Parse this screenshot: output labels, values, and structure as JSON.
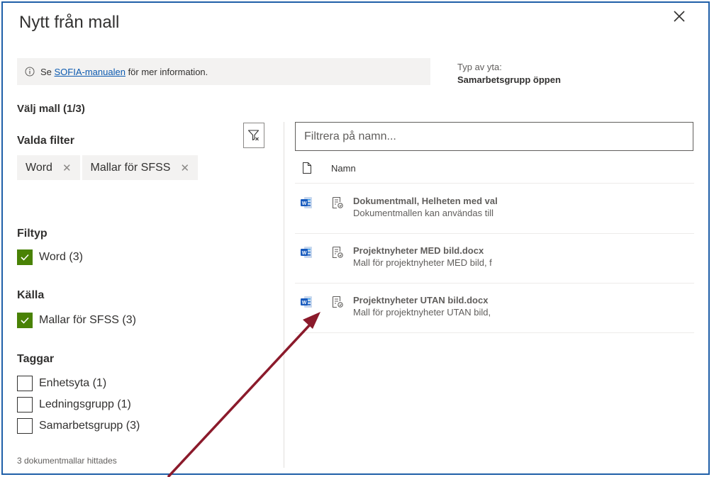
{
  "dialog": {
    "title": "Nytt från mall",
    "close_icon": "close-icon"
  },
  "info": {
    "prefix": "Se ",
    "link": "SOFIA-manualen",
    "suffix": " för mer information.",
    "icon": "info-icon"
  },
  "site_type": {
    "label": "Typ av yta:",
    "value": "Samarbetsgrupp öppen"
  },
  "select_template": "Välj mall (1/3)",
  "selected_filters": {
    "heading": "Valda filter",
    "chips": [
      "Word",
      "Mallar för SFSS"
    ],
    "clear_icon": "filter-clear-icon"
  },
  "filters": {
    "filetype": {
      "heading": "Filtyp",
      "options": [
        {
          "label": "Word (3)",
          "checked": true
        }
      ]
    },
    "source": {
      "heading": "Källa",
      "options": [
        {
          "label": "Mallar för SFSS (3)",
          "checked": true
        }
      ]
    },
    "tags": {
      "heading": "Taggar",
      "options": [
        {
          "label": "Enhetsyta (1)",
          "checked": false
        },
        {
          "label": "Ledningsgrupp (1)",
          "checked": false
        },
        {
          "label": "Samarbetsgrupp (3)",
          "checked": false
        }
      ]
    }
  },
  "result_count": "3 dokumentmallar hittades",
  "search": {
    "placeholder": "Filtrera på namn..."
  },
  "list": {
    "header_name": "Namn",
    "rows": [
      {
        "name": "Dokumentmall, Helheten med val",
        "desc": "Dokumentmallen kan användas till"
      },
      {
        "name": "Projektnyheter MED bild.docx",
        "desc": "Mall för projektnyheter MED bild, f"
      },
      {
        "name": "Projektnyheter UTAN bild.docx",
        "desc": "Mall för projektnyheter UTAN bild,"
      }
    ]
  },
  "colors": {
    "accent_check": "#498205",
    "link": "#0c5ab0",
    "frame": "#1f5fa8",
    "annotation_arrow": "#8b1a2b"
  }
}
